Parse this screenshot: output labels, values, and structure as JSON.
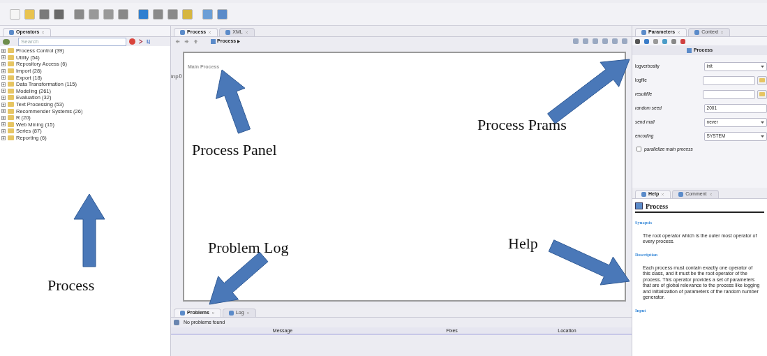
{
  "operators_panel": {
    "tabs": [
      {
        "label": "Operators",
        "selected": true
      }
    ],
    "search": {
      "placeholder": "Search"
    },
    "tree": [
      {
        "label": "Process Control (39)"
      },
      {
        "label": "Utility (54)"
      },
      {
        "label": "Repository Access (6)"
      },
      {
        "label": "Import (28)"
      },
      {
        "label": "Export (18)"
      },
      {
        "label": "Data Transformation (115)"
      },
      {
        "label": "Modeling (261)"
      },
      {
        "label": "Evaluation (32)"
      },
      {
        "label": "Text Processing (53)"
      },
      {
        "label": "Recommender Systems (26)"
      },
      {
        "label": "R (20)"
      },
      {
        "label": "Web Mining (15)"
      },
      {
        "label": "Series (87)"
      },
      {
        "label": "Reporting (6)"
      }
    ]
  },
  "process_panel": {
    "tabs": [
      {
        "label": "Process",
        "selected": true
      },
      {
        "label": "XML",
        "selected": false
      }
    ],
    "breadcrumb": "Process",
    "canvas_title": "Main Process",
    "port": "inp"
  },
  "problems_panel": {
    "tabs": [
      {
        "label": "Problems",
        "selected": true
      },
      {
        "label": "Log",
        "selected": false
      }
    ],
    "status": "No problems found",
    "columns": [
      "Message",
      "Fixes",
      "Location"
    ]
  },
  "parameters_panel": {
    "tabs": [
      {
        "label": "Parameters",
        "selected": true
      },
      {
        "label": "Context",
        "selected": false
      }
    ],
    "operator": "Process",
    "params": [
      {
        "kind": "select",
        "label": "logverbosity",
        "value": "init",
        "italic": false
      },
      {
        "kind": "file",
        "label": "logfile",
        "italic": false
      },
      {
        "kind": "file",
        "label": "resultfile",
        "italic": true
      },
      {
        "kind": "text",
        "label": "random seed",
        "value": "2001",
        "italic": true
      },
      {
        "kind": "select",
        "label": "send mail",
        "value": "never",
        "italic": true
      },
      {
        "kind": "select",
        "label": "encoding",
        "value": "SYSTEM",
        "italic": true
      }
    ],
    "checkbox": {
      "label": "parallelize main process",
      "checked": false
    }
  },
  "help_panel": {
    "tabs": [
      {
        "label": "Help",
        "selected": true
      },
      {
        "label": "Comment",
        "selected": false
      }
    ],
    "title": "Process",
    "sections": [
      {
        "heading": "Synopsis",
        "text": "The root operator which is the outer most operator of every process."
      },
      {
        "heading": "Description",
        "text": "Each process must contain exactly one operator of this class, and it must be the root operator of the process. This operator provides a set of parameters that are of global relevance to the process like logging and initialization of parameters of the random number generator."
      },
      {
        "heading": "Input"
      }
    ]
  },
  "annotations": [
    {
      "label": "Process Panel"
    },
    {
      "label": "Process Prams"
    },
    {
      "label": "Problem Log"
    },
    {
      "label": "Help"
    },
    {
      "label": "Process"
    }
  ]
}
